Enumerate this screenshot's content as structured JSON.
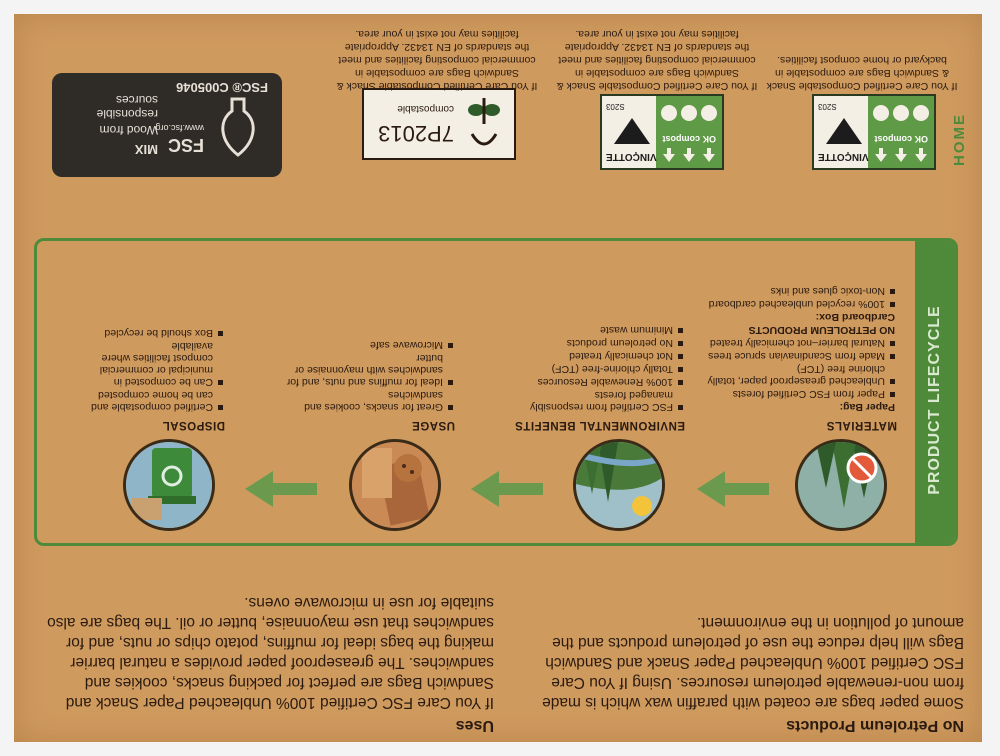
{
  "sections": {
    "no_petroleum": {
      "title": "No Petroleum Products",
      "body": "Some paper bags are coated with paraffin wax which is made from non-renewable petroleum resources. Using If You Care FSC Certified 100% Unbleached Paper Snack and Sandwich Bags will help reduce the use of petroleum products and the amount of pollution in the environment."
    },
    "uses": {
      "title": "Uses",
      "body": "If You Care FSC Certified 100% Unbleached Paper Snack and Sandwich Bags are perfect for packing snacks, cookies and sandwiches. The greaseproof paper provides a natural barrier making the bags ideal for muffins, potato chips or nuts, and for sandwiches that use mayonnaise, butter or oil. The bags are also suitable for use in microwave ovens."
    }
  },
  "lifecycle": {
    "title": "PRODUCT LIFECYCLE",
    "columns": [
      {
        "title": "MATERIALS",
        "items": [
          {
            "text": "Paper Bag:",
            "sub": true
          },
          {
            "text": "Paper from FSC Certified forests"
          },
          {
            "text": "Unbleached greaseproof paper, totally chlorine free (TCF)"
          },
          {
            "text": "Made from Scandinavian spruce trees"
          },
          {
            "text": "Natural barrier–not chemically treated"
          },
          {
            "text": "NO PETROLEUM PRODUCTS",
            "sub": true
          },
          {
            "text": "Cardboard Box:",
            "sub": true
          },
          {
            "text": "100% recycled unbleached cardboard"
          },
          {
            "text": "Non-toxic glues and inks"
          }
        ]
      },
      {
        "title": "ENVIRONMENTAL BENEFITS",
        "items": [
          {
            "text": "FSC Certified from responsibly managed forests"
          },
          {
            "text": "100% Renewable Resources"
          },
          {
            "text": "Totally chlorine-free (TCF)"
          },
          {
            "text": "Not chemically treated"
          },
          {
            "text": "No petroleum products"
          },
          {
            "text": "Minimum waste"
          }
        ]
      },
      {
        "title": "USAGE",
        "items": [
          {
            "text": "Great for snacks, cookies and sandwiches"
          },
          {
            "text": "Ideal for muffins and nuts, and for sandwiches with mayonnaise or butter"
          },
          {
            "text": "Microwave safe"
          }
        ]
      },
      {
        "title": "DISPOSAL",
        "items": [
          {
            "text": "Certified compostable and can be home composted"
          },
          {
            "text": "Can be composted in municipal or commercial compost facilities where available"
          },
          {
            "text": "Box should be recycled"
          }
        ]
      }
    ]
  },
  "certifications": {
    "home": {
      "word": "HOME",
      "ok_compost": "OK compost",
      "brand": "VINÇOTTE",
      "code": "S203",
      "text": "If You Care Certified Compostable Snack & Sandwich Bags are compostable in backyard or home compost facilities."
    },
    "industrial": {
      "ok_compost": "OK compost",
      "brand": "VINÇOTTE",
      "code": "S203",
      "text": "If You Care Certified Compostable Snack & Sandwich Bags are compostable in commercial composting facilities and meet the standards of EN 13432. Appropriate facilities may not exist in your area."
    },
    "seedling": {
      "label": "compostable",
      "code": "7P2013",
      "text": "If You Care Certified Compostable Snack & Sandwich Bags are compostable in commercial composting facilities and meet the standards of EN 13432. Appropriate facilities may not exist in your area."
    },
    "fsc": {
      "mix": "MIX",
      "line1": "Wood from",
      "line2": "responsible sources",
      "mark": "FSC",
      "url": "www.fsc.org",
      "code": "FSC® C005046"
    }
  },
  "colors": {
    "cardboard": "#cf9a5e",
    "green": "#4e8a3a",
    "ink": "#2a1a10"
  }
}
